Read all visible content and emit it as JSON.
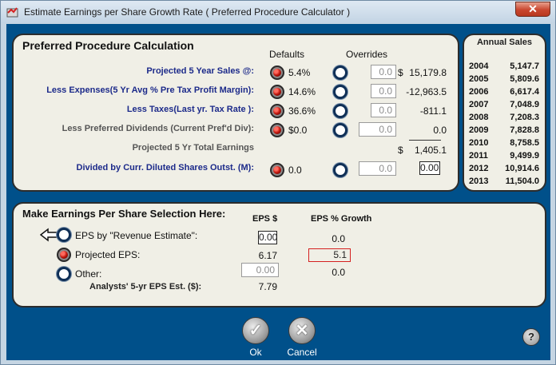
{
  "window": {
    "title": "Estimate Earnings per Share Growth Rate ( Preferred Procedure Calculator )",
    "close_label": "✕"
  },
  "preferred": {
    "heading": "Preferred Procedure Calculation",
    "defaults_header": "Defaults",
    "overrides_header": "Overrides",
    "rows": [
      {
        "label": "Projected 5 Year Sales @:",
        "default": "5.4%",
        "override": "0.0",
        "result_prefix": "$",
        "result": "15,179.8"
      },
      {
        "label": "Less Expenses(5 Yr Avg % Pre Tax Profit Margin):",
        "default": "14.6%",
        "override": "0.0",
        "result": "-12,963.5"
      },
      {
        "label": "Less Taxes(Last yr. Tax Rate ):",
        "default": "36.6%",
        "override": "0.0",
        "result": "-811.1"
      },
      {
        "label": "Less Preferred Dividends (Current Pref'd Div):",
        "default": "$0.0",
        "override": "0.0",
        "result": "0.0"
      },
      {
        "label": "Projected 5 Yr Total Earnings",
        "result_prefix": "$",
        "result": "1,405.1"
      },
      {
        "label": "Divided by Curr. Diluted Shares Outst. (M):",
        "default": "0.0",
        "override": "0.0",
        "result": "0.00"
      }
    ]
  },
  "annual_sales": {
    "heading": "Annual Sales",
    "rows": [
      {
        "year": "2004",
        "amount": "5,147.7"
      },
      {
        "year": "2005",
        "amount": "5,809.6"
      },
      {
        "year": "2006",
        "amount": "6,617.4"
      },
      {
        "year": "2007",
        "amount": "7,048.9"
      },
      {
        "year": "2008",
        "amount": "7,208.3"
      },
      {
        "year": "2009",
        "amount": "7,828.8"
      },
      {
        "year": "2010",
        "amount": "8,758.5"
      },
      {
        "year": "2011",
        "amount": "9,499.9"
      },
      {
        "year": "2012",
        "amount": "10,914.6"
      },
      {
        "year": "2013",
        "amount": "11,504.0"
      }
    ]
  },
  "eps": {
    "heading": "Make Earnings Per Share Selection Here:",
    "eps_header": "EPS $",
    "growth_header": "EPS % Growth",
    "revenue_label": "EPS by \"Revenue Estimate\":",
    "revenue_eps": "0.00",
    "revenue_growth": "0.0",
    "projected_label": "Projected EPS:",
    "projected_eps": "6.17",
    "projected_growth": "5.1",
    "other_label": "Other:",
    "other_eps": "0.00",
    "other_growth": "0.0",
    "analysts_label": "Analysts' 5-yr EPS Est. ($):",
    "analysts_value": "7.79"
  },
  "buttons": {
    "ok_label": "Ok",
    "ok_glyph": "✓",
    "cancel_label": "Cancel",
    "cancel_glyph": "✕",
    "help_glyph": "?"
  },
  "colors": {
    "accent_blue": "#00508a",
    "selected_red": "#c0160c",
    "label_blue": "#1c2a8a"
  }
}
